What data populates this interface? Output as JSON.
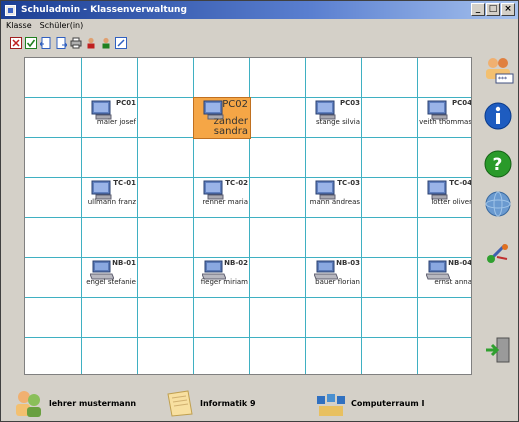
{
  "window": {
    "title": "Schuladmin - Klassenverwaltung",
    "controls": [
      "_",
      "□",
      "×"
    ]
  },
  "menu": [
    "Klasse",
    "Schüler(in)"
  ],
  "toolbar": {
    "icons": [
      "close-icon",
      "check-icon",
      "document-left-icon",
      "document-right-icon",
      "print-icon",
      "user-remove-icon",
      "user-add-icon",
      "edit-icon"
    ]
  },
  "seats": [
    {
      "id": "PC01",
      "student": "maier josef",
      "row": 1,
      "col": 1,
      "type": "pc"
    },
    {
      "id": "PC02",
      "student": "zander sandra",
      "row": 1,
      "col": 3,
      "type": "pc",
      "selected": true
    },
    {
      "id": "PC03",
      "student": "stange silvia",
      "row": 1,
      "col": 5,
      "type": "pc"
    },
    {
      "id": "PC04",
      "student": "veith thommas",
      "row": 1,
      "col": 7,
      "type": "pc"
    },
    {
      "id": "TC-01",
      "student": "ullmann franz",
      "row": 3,
      "col": 1,
      "type": "pc"
    },
    {
      "id": "TC-02",
      "student": "renner maria",
      "row": 3,
      "col": 3,
      "type": "pc"
    },
    {
      "id": "TC-03",
      "student": "mann andreas",
      "row": 3,
      "col": 5,
      "type": "pc"
    },
    {
      "id": "TC-04",
      "student": "lotter oliver",
      "row": 3,
      "col": 7,
      "type": "pc"
    },
    {
      "id": "NB-01",
      "student": "engel stefanie",
      "row": 5,
      "col": 1,
      "type": "notebook"
    },
    {
      "id": "NB-02",
      "student": "fieger miriam",
      "row": 5,
      "col": 3,
      "type": "notebook"
    },
    {
      "id": "NB-03",
      "student": "bauer florian",
      "row": 5,
      "col": 5,
      "type": "notebook"
    },
    {
      "id": "NB-04",
      "student": "ernst anna",
      "row": 5,
      "col": 7,
      "type": "notebook"
    }
  ],
  "sidebar": [
    "users-icon",
    "info-icon",
    "help-icon",
    "network-globe-icon",
    "tools-icon",
    "exit-icon"
  ],
  "bottom": {
    "teacher": "lehrer mustermann",
    "subject": "Informatik 9",
    "room": "Computerraum I"
  },
  "colors": {
    "grid_line": "#3fb0c2",
    "selected": "#f5a646",
    "title_bar": "#1c3f94"
  }
}
